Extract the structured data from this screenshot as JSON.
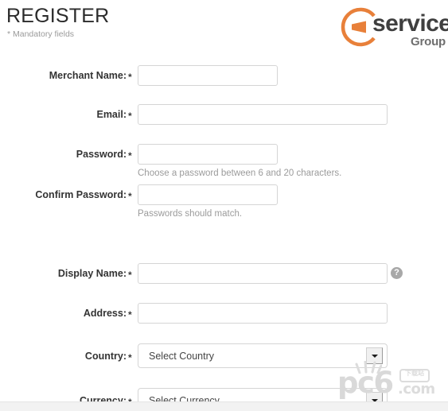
{
  "header": {
    "title": "REGISTER",
    "mandatory_note": "* Mandatory fields"
  },
  "logo": {
    "mark_name": "circle-wedge-logo-icon",
    "text_primary": "services",
    "text_secondary": "Group",
    "accent_color": "#E8803A",
    "text_color": "#3F3F3F"
  },
  "form": {
    "required_marker": "*",
    "fields": [
      {
        "name": "merchant-name",
        "label": "Merchant Name:",
        "required": true,
        "value": "",
        "placeholder": ""
      },
      {
        "name": "email",
        "label": "Email:",
        "required": true,
        "value": "",
        "placeholder": ""
      },
      {
        "name": "password",
        "label": "Password:",
        "required": true,
        "value": "",
        "placeholder": "",
        "hint": "Choose a password between 6 and 20 characters."
      },
      {
        "name": "confirm-password",
        "label": "Confirm Password:",
        "required": true,
        "value": "",
        "placeholder": "",
        "hint": "Passwords should match."
      },
      {
        "name": "display-name",
        "label": "Display Name:",
        "required": true,
        "value": "",
        "placeholder": "",
        "help_icon": "?"
      },
      {
        "name": "address",
        "label": "Address:",
        "required": true,
        "value": "",
        "placeholder": ""
      },
      {
        "name": "country",
        "label": "Country:",
        "required": true,
        "selected": "Select Country"
      },
      {
        "name": "currency",
        "label": "Currency:",
        "required": true,
        "selected": "Select Currency"
      }
    ]
  },
  "watermark": {
    "brand": "pc6",
    "domain": ".com",
    "badge": "下载站"
  }
}
